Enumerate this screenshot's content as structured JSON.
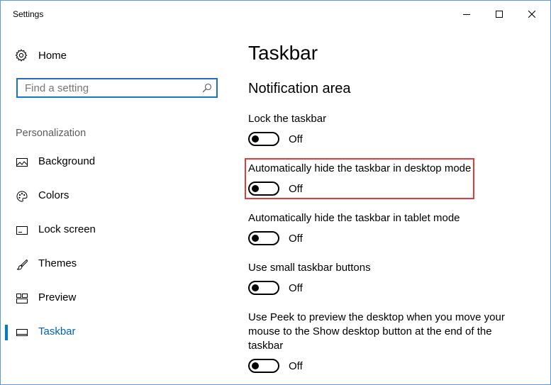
{
  "window": {
    "title": "Settings"
  },
  "sidebar": {
    "home_label": "Home",
    "search": {
      "placeholder": "Find a setting",
      "value": ""
    },
    "section_label": "Personalization",
    "items": [
      {
        "label": "Background",
        "icon": "image-icon"
      },
      {
        "label": "Colors",
        "icon": "palette-icon"
      },
      {
        "label": "Lock screen",
        "icon": "lock-screen-icon"
      },
      {
        "label": "Themes",
        "icon": "brush-icon"
      },
      {
        "label": "Preview",
        "icon": "preview-grid-icon"
      },
      {
        "label": "Taskbar",
        "icon": "taskbar-icon",
        "selected": true
      }
    ]
  },
  "main": {
    "title": "Taskbar",
    "section_title": "Notification area",
    "settings": [
      {
        "label": "Lock the taskbar",
        "state": "Off"
      },
      {
        "label": "Automatically hide the taskbar in desktop mode",
        "state": "Off",
        "highlighted": true
      },
      {
        "label": "Automatically hide the taskbar in tablet mode",
        "state": "Off"
      },
      {
        "label": "Use small taskbar buttons",
        "state": "Off"
      },
      {
        "label": "Use Peek to preview the desktop when you move your mouse to the Show desktop button at the end of the taskbar",
        "state": "Off"
      }
    ]
  },
  "colors": {
    "accent": "#0078d7",
    "highlight": "#e03c3c",
    "window_border": "#5a9bd5"
  }
}
